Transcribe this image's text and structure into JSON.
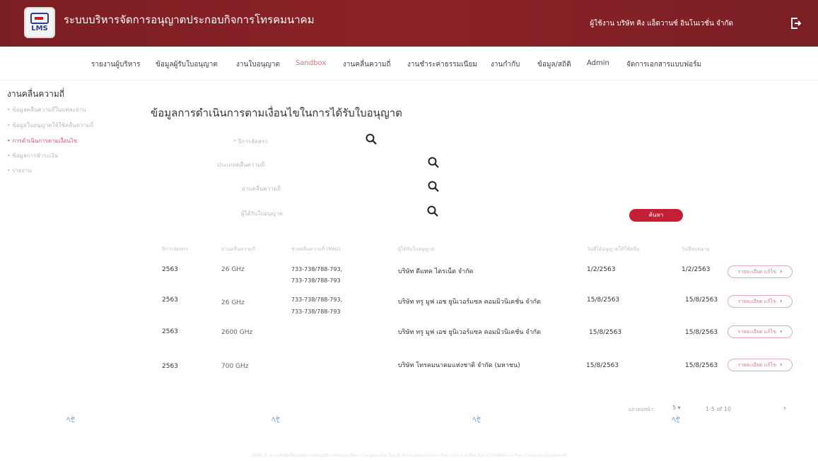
{
  "header": {
    "logo_text": "LMS",
    "app_title": "ระบบบริหารจัดการอนุญาตประกอบกิจการโทรคมนาคม",
    "user_info": "ผู้ใช้งาน  บริษัท คิง แอ็ดวานซ์ อินโนเวชั่น จำกัด"
  },
  "nav": [
    "รายงานผู้บริหาร",
    "ข้อมูลผู้รับใบอนุญาต",
    "งานใบอนุญาต",
    "Sandbox",
    "งานคลื่นความถี่",
    "งานชำระค่าธรรมเนียม",
    "งานกำกับ",
    "ข้อมูล/สถิติ",
    "Admin",
    "จัดการเอกสารแบบฟอร์ม"
  ],
  "sidebar": {
    "title": "งานคลื่นความถี่",
    "items": [
      "• ข้อมูลคลื่นความถี่ในแต่ละย่าน",
      "• ข้อมูลใบอนุญาตให้ใช้คลื่นความถี่",
      "• การดำเนินการตามเงื่อนไข",
      "• ข้อมูลการชำระเงิน",
      "• รายงาน"
    ]
  },
  "main": {
    "title": "ข้อมูลการดำเนินการตามเงื่อนไขในการได้รับใบอนุญาต",
    "filters": {
      "year": "* ปีการจัดสรร",
      "band_type": "ประเภทคลื่นความถี่",
      "band": "ย่านคลื่นความถี่",
      "licensee": "ผู้ได้รับใบอนุญาต"
    },
    "search_button": "ค้นหา"
  },
  "table": {
    "headers": [
      "ปีการจัดสรร",
      "ย่านคลื่นความถี่",
      "ช่วงคลื่นความถี่ (MHz)",
      "ผู้ได้รับใบอนุญาต",
      "วันที่ได้อนุญาตให้ใช้คลื่น",
      "วันที่หมดอายุ"
    ],
    "rows": [
      {
        "year": "2563",
        "band": "26 GHz",
        "range1": "733-738/788-793,",
        "range2": "733-738/788-793",
        "licensee": "บริษัท ดีแทค ไตรเน็ต จำกัด",
        "start": "1/2/2563",
        "end": "1/2/2563"
      },
      {
        "year": "2563",
        "band": "26 GHz",
        "range1": "733-738/788-793,",
        "range2": "733-738/788-793",
        "licensee": "บริษัท ทรู มูฟ เอช ยูนิเวอร์แซล คอมมิวนิเคชั่น จำกัด",
        "start": "15/8/2563",
        "end": "15/8/2563"
      },
      {
        "year": "2563",
        "band": "2600 GHz",
        "range1": "",
        "range2": "",
        "licensee": "บริษัท ทรู มูฟ เอช ยูนิเวอร์แซล คอมมิวนิเคชั่น จำกัด",
        "start": "15/8/2563",
        "end": "15/8/2563"
      },
      {
        "year": "2563",
        "band": "700 GHz",
        "range1": "",
        "range2": "",
        "licensee": "บริษัท โทรคมนาคมแห่งชาติ จำกัด (มหาชน)",
        "start": "15/8/2563",
        "end": "15/8/2563"
      }
    ],
    "detail_label": "รายละเอียด แก้ไข"
  },
  "pagination": {
    "rows_label": "แถวต่อหน้า:",
    "rows_value": "5 ▾",
    "range": "1-5 of 10"
  },
  "footer": "2563 © สงวนลิขสิทธิ์ตามพระราชบัญญัติการประกอบกิจการโทรคมนาคม โดย สำนักงานคณะกรรมการกิจการกระจายเสียง กิจการโทรทัศน์ และกิจการโทรคมนาคมแห่งชาติ"
}
